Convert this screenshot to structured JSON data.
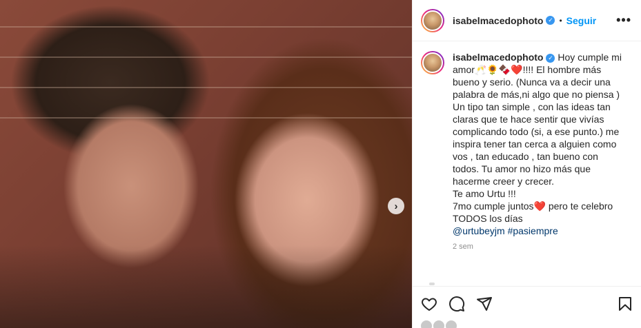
{
  "post": {
    "username": "isabelmacedophoto",
    "dot": "•",
    "follow_label": "Seguir",
    "more_label": "•••",
    "next_label": "›",
    "caption": {
      "username": "isabelmacedophoto",
      "text": " Hoy cumple mi amor🥂🌻🍫❤️!!!! El hombre más bueno y serio. (Nunca va a decir una palabra de más,ni algo que no piensa )\nUn tipo tan simple , con las ideas tan claras que te hace sentir que vivías complicando todo (si, a ese punto.) me inspira tener tan cerca a alguien como vos , tan educado , tan bueno con todos. Tu amor no hizo más que hacerme creer y crecer.\nTe amo Urtu !!!\n7mo cumple juntos❤️ pero te celebro TODOS los días\n",
      "mention": "@urtubeyjm",
      "hashtag": "#pasiempre"
    },
    "timestamp": "2 sem"
  },
  "icons": {
    "verified": "verified-badge-icon",
    "like": "heart-icon",
    "comment": "comment-icon",
    "share": "share-icon",
    "save": "bookmark-icon",
    "next": "chevron-right-icon"
  },
  "colors": {
    "accent": "#0095f6",
    "verified": "#3897f0",
    "mention": "#00376b",
    "muted": "#8e8e8e"
  }
}
